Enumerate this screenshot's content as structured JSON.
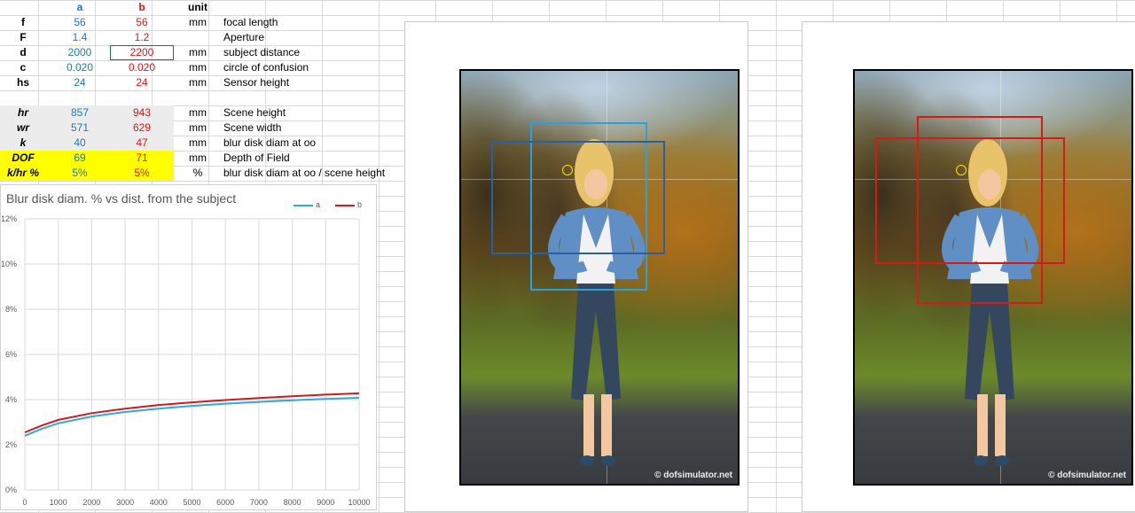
{
  "header": {
    "col_a": "a",
    "col_b": "b",
    "col_unit": "unit"
  },
  "rows": [
    {
      "key": "f",
      "a": "56",
      "b": "56",
      "unit": "mm",
      "label": "focal length"
    },
    {
      "key": "F",
      "a": "1.4",
      "b": "1.2",
      "unit": "",
      "label": "Aperture"
    },
    {
      "key": "d",
      "a": "2000",
      "b": "2200",
      "unit": "mm",
      "label": "subject distance"
    },
    {
      "key": "c",
      "a": "0.020",
      "b": "0.020",
      "unit": "mm",
      "label": "circle of confusion"
    },
    {
      "key": "hs",
      "a": "24",
      "b": "24",
      "unit": "mm",
      "label": "Sensor height"
    }
  ],
  "results": [
    {
      "key": "hr",
      "a": "857",
      "b": "943",
      "unit": "mm",
      "label": "Scene height"
    },
    {
      "key": "wr",
      "a": "571",
      "b": "629",
      "unit": "mm",
      "label": "Scene width"
    },
    {
      "key": "k",
      "a": "40",
      "b": "47",
      "unit": "mm",
      "label": "blur disk diam at oo"
    },
    {
      "key": "DOF",
      "a": "69",
      "b": "71",
      "unit": "mm",
      "label": "Depth of Field"
    },
    {
      "key": "k/hr %",
      "a": "5%",
      "b": "5%",
      "unit": "%",
      "label": "blur disk diam at oo / scene height"
    }
  ],
  "colors": {
    "a": "#1f78b4",
    "b": "#d51a1a",
    "highlight": "#ffff00"
  },
  "watermark": "© dofsimulator.net",
  "chart_data": {
    "type": "line",
    "title": "Blur disk diam. % vs dist. from the subject",
    "xlabel": "",
    "ylabel": "",
    "xlim": [
      0,
      10000
    ],
    "ylim": [
      0,
      12
    ],
    "x_ticks": [
      "0",
      "1000",
      "2000",
      "3000",
      "4000",
      "5000",
      "6000",
      "7000",
      "8000",
      "9000",
      "10000"
    ],
    "y_ticks": [
      "0%",
      "2%",
      "4%",
      "6%",
      "8%",
      "10%",
      "12%"
    ],
    "legend_position": "top-right",
    "grid": true,
    "x": [
      0,
      500,
      1000,
      2000,
      3000,
      4000,
      5000,
      6000,
      7000,
      8000,
      9000,
      10000
    ],
    "series": [
      {
        "name": "a",
        "color": "#35a6d9",
        "values": [
          2.4,
          2.7,
          2.95,
          3.25,
          3.45,
          3.6,
          3.72,
          3.82,
          3.9,
          3.97,
          4.03,
          4.08
        ]
      },
      {
        "name": "b",
        "color": "#c81e1e",
        "values": [
          2.55,
          2.85,
          3.1,
          3.4,
          3.6,
          3.76,
          3.88,
          3.98,
          4.07,
          4.15,
          4.22,
          4.28
        ]
      }
    ]
  }
}
